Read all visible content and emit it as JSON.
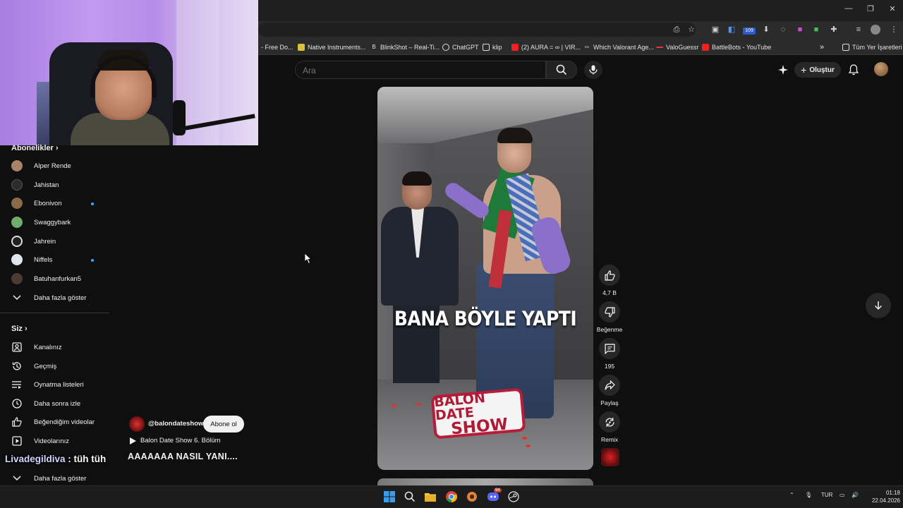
{
  "browser": {
    "bookmarks": [
      {
        "label": "- Free Do...",
        "icon": "page-icon"
      },
      {
        "label": "Native Instruments...",
        "icon": "folder-icon"
      },
      {
        "label": "BlinkShot – Real-Ti...",
        "icon": "blinkshot-icon"
      },
      {
        "label": "ChatGPT",
        "icon": "chatgpt-icon"
      },
      {
        "label": "klip",
        "icon": "folder-icon"
      },
      {
        "label": "(2) AURA = ∞ | VIR...",
        "icon": "youtube-icon"
      },
      {
        "label": "Which Valorant Age...",
        "icon": "link-icon"
      },
      {
        "label": "ValoGuessr",
        "icon": "valoguessr-icon"
      },
      {
        "label": "BattleBots - YouTube",
        "icon": "youtube-icon"
      }
    ],
    "more_bookmarks": "»",
    "all_bookmarks": "Tüm Yer İşaretleri",
    "extension_badge": "109"
  },
  "youtube_header": {
    "search_placeholder": "Ara",
    "create_label": "Oluştur"
  },
  "sidebar": {
    "subscriptions_title": "Abonelikler",
    "subscriptions": [
      {
        "label": "Alper Rende",
        "color": "#a8826a",
        "new": false
      },
      {
        "label": "Jahistan",
        "color": "#2b2b2b",
        "new": false
      },
      {
        "label": "Ebonivon",
        "color": "#8a6a48",
        "new": true
      },
      {
        "label": "Swaggybark",
        "color": "#6fae6a",
        "new": false
      },
      {
        "label": "Jahrein",
        "color": "#222222",
        "new": false
      },
      {
        "label": "Niffels",
        "color": "#dfe6ee",
        "new": true
      },
      {
        "label": "Batuhanfurkan5",
        "color": "#4a3b33",
        "new": false
      }
    ],
    "show_more": "Daha fazla göster",
    "you_title": "Siz",
    "you_items": [
      {
        "label": "Kanalınız",
        "icon": "channel-icon"
      },
      {
        "label": "Geçmiş",
        "icon": "history-icon"
      },
      {
        "label": "Oynatma listeleri",
        "icon": "playlists-icon"
      },
      {
        "label": "Daha sonra izle",
        "icon": "watch-later-icon"
      },
      {
        "label": "Beğendiğim videolar",
        "icon": "liked-icon"
      },
      {
        "label": "Videolarınız",
        "icon": "your-videos-icon"
      }
    ],
    "show_more_2": "Daha fazla göster"
  },
  "short": {
    "caption": "BANA BÖYLE YAPTI",
    "logo_line1": "BALON DATE",
    "logo_line2": "SHOW",
    "channel": "@balondateshow",
    "subscribe": "Abone ol",
    "playlist": "Balon Date Show 6. Bölüm",
    "title": "AAAAAAA NASIL YANI....",
    "likes": "4,7 B",
    "dislike_label": "Beğenme",
    "comments": "195",
    "share_label": "Paylaş",
    "remix_label": "Remix"
  },
  "stream_chat": {
    "user": "Livadegildiva",
    "message": " : tüh tüh"
  },
  "taskbar": {
    "language": "TUR",
    "time": "01:18",
    "date": "22.04.2026",
    "discord_badge": "94"
  }
}
